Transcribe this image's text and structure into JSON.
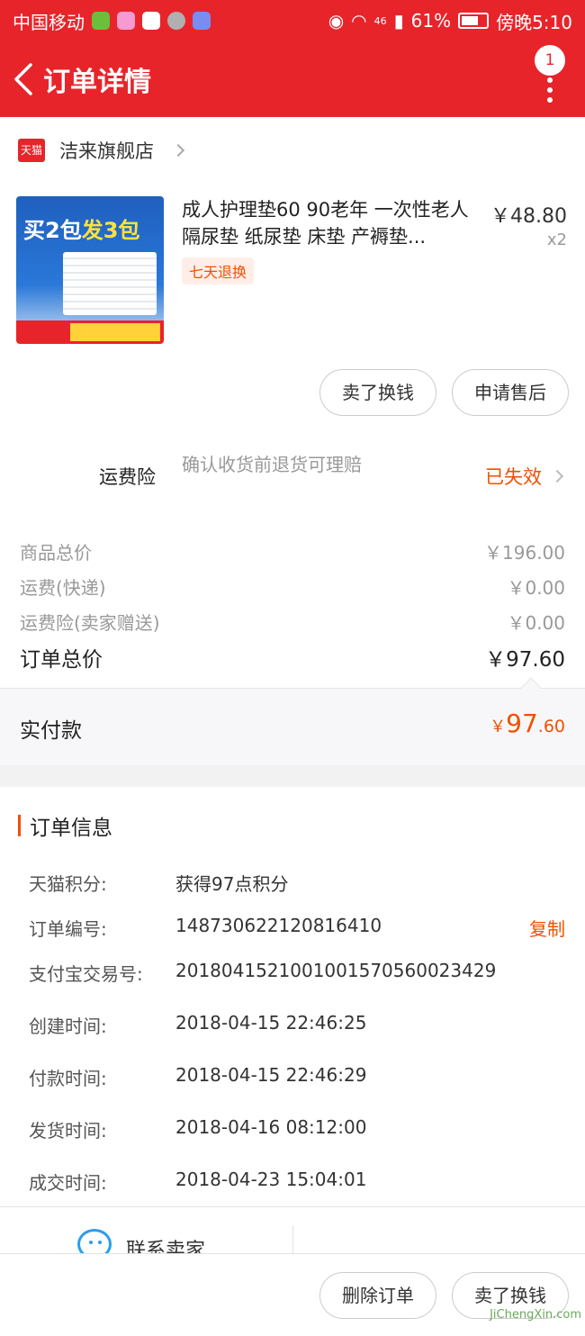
{
  "status_bar": {
    "carrier": "中国移动",
    "network": "46",
    "battery": "61%",
    "time": "傍晚5:10"
  },
  "nav": {
    "title": "订单详情",
    "badge": "1"
  },
  "shop": {
    "platform_logo": "天猫",
    "name": "洁来旗舰店"
  },
  "product": {
    "image_text": {
      "headline_a": "买2包",
      "headline_b": "发3包"
    },
    "title": "成人护理垫60 90老年 一次性老人隔尿垫 纸尿垫 床垫 产褥垫...",
    "tag": "七天退换",
    "price": "￥48.80",
    "quantity": "x2"
  },
  "item_actions": {
    "sell": "卖了换钱",
    "after_sale": "申请售后"
  },
  "insurance": {
    "label": "运费险",
    "desc": "确认收货前退货可理赔",
    "status": "已失效"
  },
  "summary": {
    "rows": [
      {
        "label": "商品总价",
        "value": "￥196.00"
      },
      {
        "label": "运费(快递)",
        "value": "￥0.00"
      },
      {
        "label": "运费险(卖家赠送)",
        "value": "￥0.00"
      }
    ],
    "total_label": "订单总价",
    "total_value": "￥97.60"
  },
  "paid": {
    "label": "实付款",
    "currency": "￥",
    "integer": "97",
    "decimal": ".60"
  },
  "order_info": {
    "heading": "订单信息",
    "rows": [
      {
        "label": "天猫积分:",
        "value": "获得97点积分"
      },
      {
        "label": "订单编号:",
        "value": "148730622120816410"
      },
      {
        "label": "支付宝交易号:",
        "value": "2018041521001001570560023429"
      },
      {
        "label": "创建时间:",
        "value": "2018-04-15 22:46:25"
      },
      {
        "label": "付款时间:",
        "value": "2018-04-15 22:46:29"
      },
      {
        "label": "发货时间:",
        "value": "2018-04-16 08:12:00"
      },
      {
        "label": "成交时间:",
        "value": "2018-04-23 15:04:01"
      }
    ],
    "copy_label": "复制"
  },
  "contact": {
    "label": "联系卖家"
  },
  "bottom_actions": {
    "delete": "删除订单",
    "sell": "卖了换钱"
  },
  "watermark": "JiChengXin.com",
  "colors": {
    "brand_red": "#e8242b",
    "accent_orange": "#f05000"
  },
  "icons": [
    "back-arrow-icon",
    "more-vertical-icon",
    "chevron-right-icon",
    "chat-bubble-icon",
    "wifi-icon",
    "signal-icon",
    "battery-icon",
    "eye-icon"
  ]
}
